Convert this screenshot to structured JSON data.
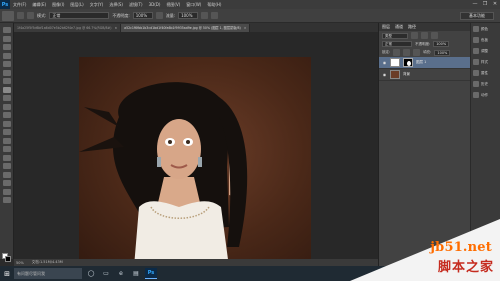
{
  "app": {
    "logo": "Ps"
  },
  "menu": {
    "items": [
      "文件(F)",
      "编辑(E)",
      "图像(I)",
      "图层(L)",
      "文字(Y)",
      "选择(S)",
      "滤镜(T)",
      "3D(D)",
      "视图(V)",
      "窗口(W)",
      "帮助(H)"
    ]
  },
  "window_controls": {
    "minimize": "—",
    "maximize": "❐",
    "close": "✕"
  },
  "options": {
    "mode_label": "模式:",
    "mode_value": "正常",
    "opacity_label": "不透明度:",
    "opacity_value": "100%",
    "flow_label": "流量:",
    "flow_value": "100%",
    "workspace": "基本功能"
  },
  "tabs": [
    {
      "label": "1f4a25f5f5d6bf1a6d07e5b2b62f4e7.jpg @ 66.7%(RGB/8#)",
      "close": "×"
    },
    {
      "label": "a52c1f6fbb1b3cd1bd1f40fa6b1f9935ad9e.jpg @ 50% (图层 1, 图层蒙版/8)",
      "close": "×"
    }
  ],
  "status": {
    "zoom": "50%",
    "doc_info": "文档:1.51M/4.43M"
  },
  "layers_panel": {
    "tabs": [
      "图层",
      "通道",
      "路径"
    ],
    "kind_label": "类型",
    "blend_mode": "正常",
    "opacity_label": "不透明度:",
    "opacity_value": "100%",
    "lock_label": "锁定:",
    "fill_label": "填充:",
    "fill_value": "100%",
    "layers": [
      {
        "name": "图层 1",
        "selected": true
      },
      {
        "name": "背景",
        "selected": false
      }
    ]
  },
  "mini_panels": [
    "颜色",
    "色板",
    "调整",
    "样式",
    "属性",
    "历史",
    "动作"
  ],
  "taskbar": {
    "start": "⊞",
    "search_placeholder": "有问题尽管问我",
    "apps": [
      "◯",
      "▭",
      "e",
      "▤",
      "Ps"
    ]
  },
  "watermark": {
    "site": "jb51.net",
    "name": "脚本之家"
  },
  "colors": {
    "accent": "#31a8ff",
    "selected_layer": "#5a6f8c",
    "photo_background": "#4a2818",
    "watermark_orange": "#ff6d00",
    "watermark_red": "#c52b1f"
  }
}
